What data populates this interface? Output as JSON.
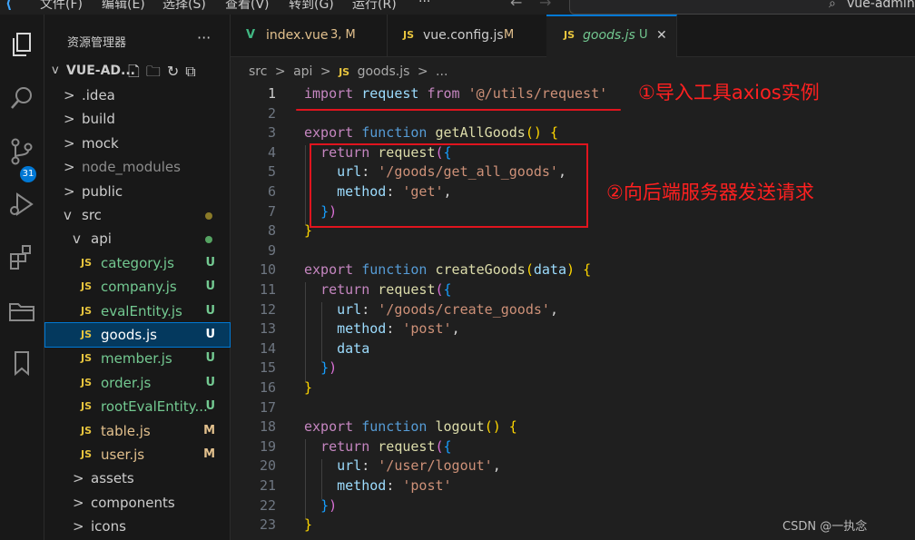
{
  "menubar": {
    "items": [
      "文件(F)",
      "编辑(E)",
      "选择(S)",
      "查看(V)",
      "转到(G)",
      "运行(R)",
      "···"
    ],
    "search_text": "vue-admin-"
  },
  "activity": {
    "scm_badge": "31"
  },
  "sidebar": {
    "title": "资源管理器",
    "more": "···",
    "root": "VUE-AD...",
    "tree": [
      {
        "label": ".idea",
        "type": "folder",
        "chev": ">",
        "status": ""
      },
      {
        "label": "build",
        "type": "folder",
        "chev": ">",
        "status": ""
      },
      {
        "label": "mock",
        "type": "folder",
        "chev": ">",
        "status": ""
      },
      {
        "label": "node_modules",
        "type": "folder",
        "chev": ">",
        "status": ""
      },
      {
        "label": "public",
        "type": "folder",
        "chev": ">",
        "status": ""
      },
      {
        "label": "src",
        "type": "folder",
        "chev": "v",
        "status": "dot"
      },
      {
        "label": "api",
        "type": "folder",
        "chev": "v",
        "status": "dot-green"
      },
      {
        "label": "category.js",
        "type": "js",
        "status": "U"
      },
      {
        "label": "company.js",
        "type": "js",
        "status": "U"
      },
      {
        "label": "evalEntity.js",
        "type": "js",
        "status": "U"
      },
      {
        "label": "goods.js",
        "type": "js",
        "status": "U",
        "selected": true
      },
      {
        "label": "member.js",
        "type": "js",
        "status": "U"
      },
      {
        "label": "order.js",
        "type": "js",
        "status": "U"
      },
      {
        "label": "rootEvalEntity...",
        "type": "js",
        "status": "U"
      },
      {
        "label": "table.js",
        "type": "js",
        "status": "M"
      },
      {
        "label": "user.js",
        "type": "js",
        "status": "M"
      },
      {
        "label": "assets",
        "type": "folder",
        "chev": ">",
        "status": ""
      },
      {
        "label": "components",
        "type": "folder",
        "chev": ">",
        "status": ""
      },
      {
        "label": "icons",
        "type": "folder",
        "chev": ">",
        "status": ""
      }
    ]
  },
  "tabs": [
    {
      "icon": "V",
      "label": "index.vue",
      "suffix": "3, M"
    },
    {
      "icon": "JS",
      "label": "vue.config.js",
      "suffix": "M"
    },
    {
      "icon": "JS",
      "label": "goods.js",
      "suffix": "U",
      "close": "✕"
    }
  ],
  "breadcrumb": [
    "src",
    ">",
    "api",
    ">",
    "JS",
    "goods.js",
    ">",
    "..."
  ],
  "editor": {
    "line_numbers": [
      "1",
      "2",
      "3",
      "4",
      "5",
      "6",
      "7",
      "8",
      "9",
      "10",
      "11",
      "12",
      "13",
      "14",
      "15",
      "16",
      "17",
      "18",
      "19",
      "20",
      "21",
      "22",
      "23"
    ],
    "lines": [
      [
        [
          "kw2",
          "import"
        ],
        [
          "t",
          " "
        ],
        [
          "prop",
          "request"
        ],
        [
          "t",
          " "
        ],
        [
          "kw2",
          "from"
        ],
        [
          "t",
          " "
        ],
        [
          "str",
          "'@/utils/request'"
        ]
      ],
      [],
      [
        [
          "kw2",
          "export"
        ],
        [
          "t",
          " "
        ],
        [
          "kw",
          "function"
        ],
        [
          "t",
          " "
        ],
        [
          "fn",
          "getAllGoods"
        ],
        [
          "p1",
          "()"
        ],
        [
          "t",
          " "
        ],
        [
          "p1",
          "{"
        ]
      ],
      [
        [
          "t",
          "  "
        ],
        [
          "kw2",
          "return"
        ],
        [
          "t",
          " "
        ],
        [
          "fn",
          "request"
        ],
        [
          "p2",
          "("
        ],
        [
          "p3",
          "{"
        ]
      ],
      [
        [
          "t",
          "    "
        ],
        [
          "prop",
          "url"
        ],
        [
          "t",
          ": "
        ],
        [
          "str",
          "'/goods/get_all_goods'"
        ],
        [
          "t",
          ","
        ]
      ],
      [
        [
          "t",
          "    "
        ],
        [
          "prop",
          "method"
        ],
        [
          "t",
          ": "
        ],
        [
          "str",
          "'get'"
        ],
        [
          "t",
          ","
        ]
      ],
      [
        [
          "t",
          "  "
        ],
        [
          "p3",
          "}"
        ],
        [
          "p2",
          ")"
        ]
      ],
      [
        [
          "p1",
          "}"
        ]
      ],
      [],
      [
        [
          "kw2",
          "export"
        ],
        [
          "t",
          " "
        ],
        [
          "kw",
          "function"
        ],
        [
          "t",
          " "
        ],
        [
          "fn",
          "createGoods"
        ],
        [
          "p1",
          "("
        ],
        [
          "prop",
          "data"
        ],
        [
          "p1",
          ")"
        ],
        [
          "t",
          " "
        ],
        [
          "p1",
          "{"
        ]
      ],
      [
        [
          "t",
          "  "
        ],
        [
          "kw2",
          "return"
        ],
        [
          "t",
          " "
        ],
        [
          "fn",
          "request"
        ],
        [
          "p2",
          "("
        ],
        [
          "p3",
          "{"
        ]
      ],
      [
        [
          "t",
          "    "
        ],
        [
          "prop",
          "url"
        ],
        [
          "t",
          ": "
        ],
        [
          "str",
          "'/goods/create_goods'"
        ],
        [
          "t",
          ","
        ]
      ],
      [
        [
          "t",
          "    "
        ],
        [
          "prop",
          "method"
        ],
        [
          "t",
          ": "
        ],
        [
          "str",
          "'post'"
        ],
        [
          "t",
          ","
        ]
      ],
      [
        [
          "t",
          "    "
        ],
        [
          "prop",
          "data"
        ]
      ],
      [
        [
          "t",
          "  "
        ],
        [
          "p3",
          "}"
        ],
        [
          "p2",
          ")"
        ]
      ],
      [
        [
          "p1",
          "}"
        ]
      ],
      [],
      [
        [
          "kw2",
          "export"
        ],
        [
          "t",
          " "
        ],
        [
          "kw",
          "function"
        ],
        [
          "t",
          " "
        ],
        [
          "fn",
          "logout"
        ],
        [
          "p1",
          "()"
        ],
        [
          "t",
          " "
        ],
        [
          "p1",
          "{"
        ]
      ],
      [
        [
          "t",
          "  "
        ],
        [
          "kw2",
          "return"
        ],
        [
          "t",
          " "
        ],
        [
          "fn",
          "request"
        ],
        [
          "p2",
          "("
        ],
        [
          "p3",
          "{"
        ]
      ],
      [
        [
          "t",
          "    "
        ],
        [
          "prop",
          "url"
        ],
        [
          "t",
          ": "
        ],
        [
          "str",
          "'/user/logout'"
        ],
        [
          "t",
          ","
        ]
      ],
      [
        [
          "t",
          "    "
        ],
        [
          "prop",
          "method"
        ],
        [
          "t",
          ": "
        ],
        [
          "str",
          "'post'"
        ]
      ],
      [
        [
          "t",
          "  "
        ],
        [
          "p3",
          "}"
        ],
        [
          "p2",
          ")"
        ]
      ],
      [
        [
          "p1",
          "}"
        ]
      ]
    ]
  },
  "annotations": {
    "note1": "①导入工具axios实例",
    "note2": "②向后端服务器发送请求"
  },
  "watermark": "CSDN @一执念",
  "colors": {
    "accent": "#0078d4",
    "annotation_red": "#e0141e",
    "untracked": "#73c991",
    "modified": "#e2c08d"
  }
}
